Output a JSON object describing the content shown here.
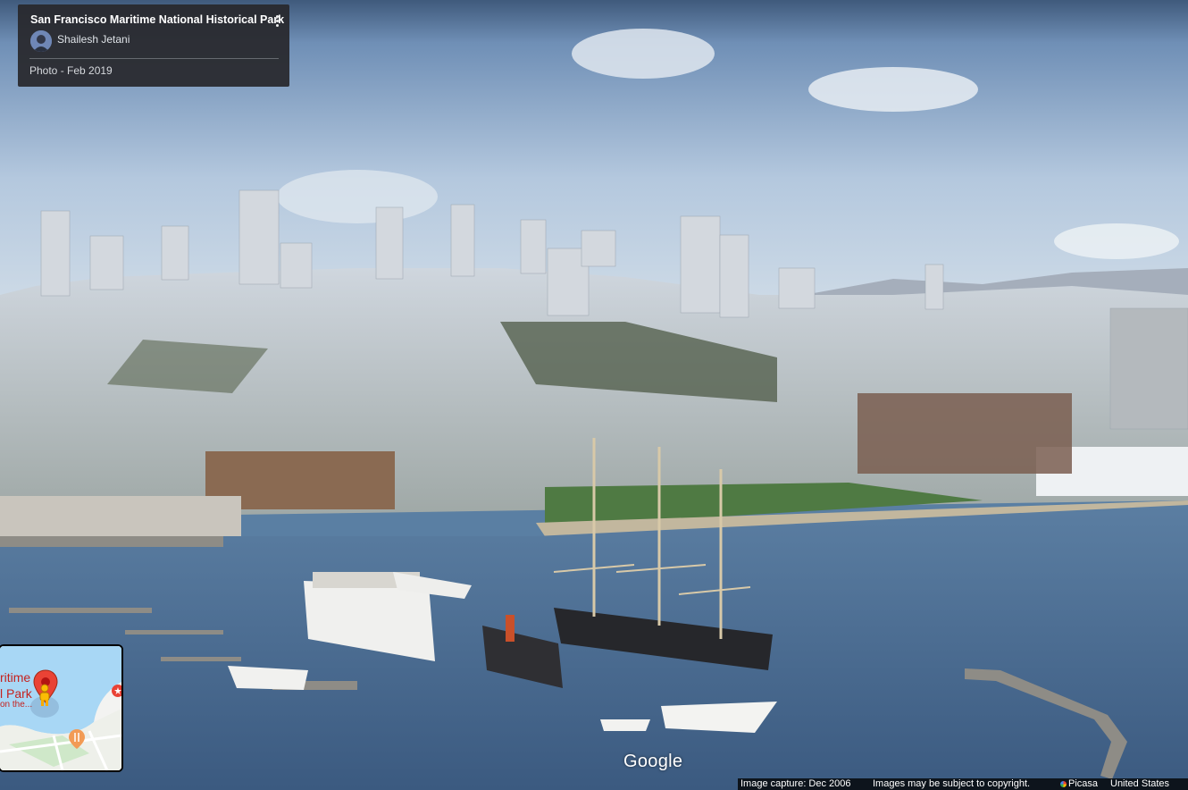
{
  "photo_card": {
    "title": "San Francisco Maritime National Historical Park",
    "author": "Shailesh Jetani",
    "photo_date": "Photo - Feb 2019",
    "more_icon": "more-vert-icon"
  },
  "minimap": {
    "label_line1": "ritime",
    "label_line2": "l Park",
    "label_line3": "on the...",
    "icons": [
      "red-map-pin-icon",
      "pegman-icon",
      "restaurant-pin-icon",
      "attraction-pin-icon"
    ]
  },
  "branding": {
    "google": "Google"
  },
  "footer": {
    "capture": "Image capture: Dec 2006",
    "copyright": "Images may be subject to copyright.",
    "picasa": "Picasa",
    "country": "United States"
  },
  "colors": {
    "card_bg": "#2a2a2e",
    "water": "#4f7196",
    "sky": "#a9c3df",
    "pin_red": "#ea4335"
  }
}
